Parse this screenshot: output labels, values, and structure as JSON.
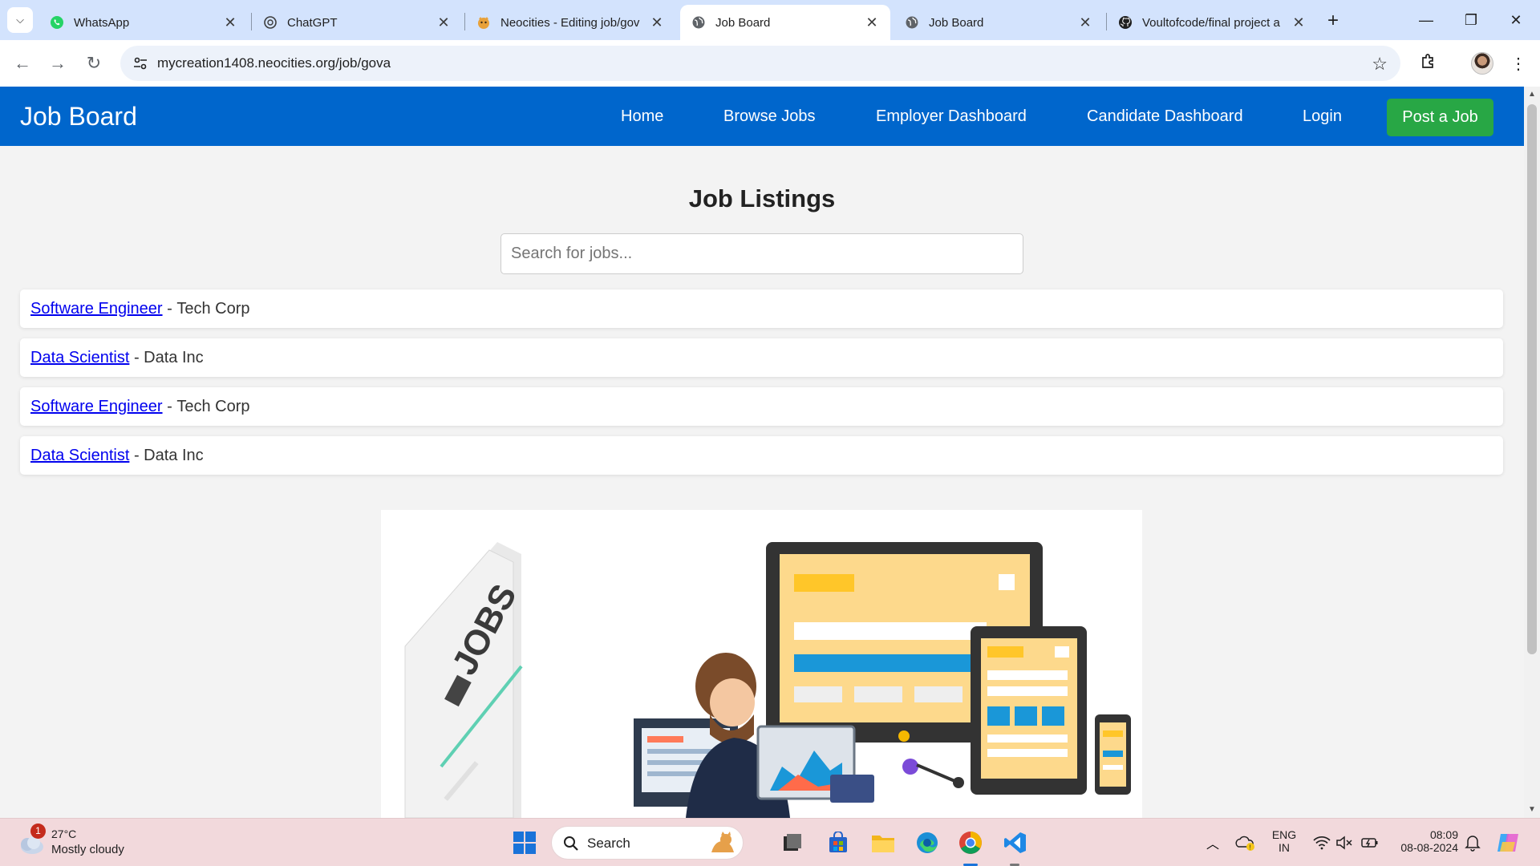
{
  "browser": {
    "tabs": [
      {
        "title": "WhatsApp",
        "icon": "whatsapp-icon",
        "active": false
      },
      {
        "title": "ChatGPT",
        "icon": "chatgpt-icon",
        "active": false
      },
      {
        "title": "Neocities - Editing job/gov",
        "icon": "neocities-icon",
        "active": false
      },
      {
        "title": "Job Board",
        "icon": "globe-icon",
        "active": true
      },
      {
        "title": "Job Board",
        "icon": "globe-icon",
        "active": false
      },
      {
        "title": "Voultofcode/final project a",
        "icon": "github-icon",
        "active": false
      }
    ],
    "url": "mycreation1408.neocities.org/job/gova"
  },
  "site": {
    "brand": "Job Board",
    "nav": {
      "home": "Home",
      "browse": "Browse Jobs",
      "employer": "Employer Dashboard",
      "candidate": "Candidate Dashboard",
      "login": "Login",
      "post": "Post a Job"
    },
    "colors": {
      "header": "#0066cc",
      "post_button": "#28a745"
    },
    "heading": "Job Listings",
    "search_placeholder": "Search for jobs...",
    "jobs": [
      {
        "title": "Software Engineer",
        "company": "Tech Corp"
      },
      {
        "title": "Data Scientist",
        "company": "Data Inc"
      },
      {
        "title": "Software Engineer",
        "company": "Tech Corp"
      },
      {
        "title": "Data Scientist",
        "company": "Data Inc"
      }
    ],
    "illustration_text": "JOBS"
  },
  "taskbar": {
    "weather": {
      "temp": "27°C",
      "condition": "Mostly cloudy",
      "badge": "1"
    },
    "search_label": "Search",
    "lang_top": "ENG",
    "lang_bottom": "IN",
    "time": "08:09",
    "date": "08-08-2024"
  }
}
